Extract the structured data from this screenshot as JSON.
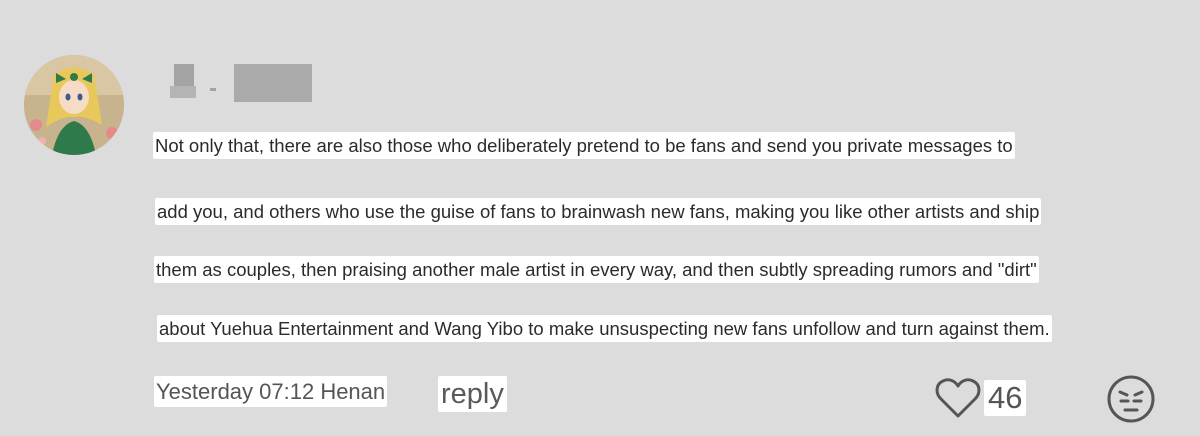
{
  "comment": {
    "lines": [
      "Not only that, there are also those who deliberately pretend to be fans and send you private messages to",
      "add you, and others who use the guise of fans to brainwash new fans, making you like other artists and ship",
      "them as couples, then praising another male artist in every way, and then subtly spreading rumors and \"dirt\"",
      "about Yuehua Entertainment and Wang Yibo to make unsuspecting new fans unfollow and turn against them."
    ],
    "timestamp_location": "Yesterday 07:12 Henan",
    "reply_label": "reply",
    "like_count": "46"
  },
  "icons": {
    "like": "heart-outline-icon",
    "reaction": "neutral-face-icon"
  },
  "colors": {
    "background": "#dcdcdc",
    "text_highlight": "#ffffff",
    "icon": "#555555"
  }
}
